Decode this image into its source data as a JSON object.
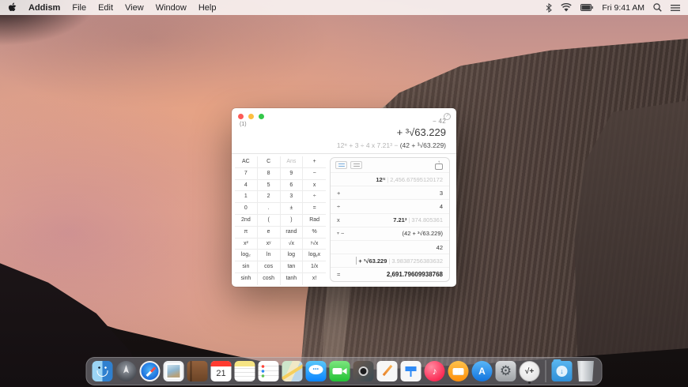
{
  "menubar": {
    "app_name": "Addism",
    "menus": [
      "File",
      "Edit",
      "View",
      "Window",
      "Help"
    ],
    "clock": "Fri 9:41 AM",
    "status_icons": [
      "bluetooth-icon",
      "wifi-icon",
      "battery-icon",
      "spotlight-icon",
      "notification-center-icon"
    ]
  },
  "window": {
    "tab_label": "(1)",
    "display": {
      "line1": "− 42",
      "line2": "+ ³√63.229",
      "expr": {
        "p1": "12",
        "s1": "π",
        "p2": " + 3 ÷ 4 x 7.21",
        "s2": "3",
        "p3": " − ",
        "dark": "(42 + ³√63.229)"
      }
    },
    "keypad": {
      "keys": [
        "AC",
        "C",
        "Ans",
        "+",
        "7",
        "8",
        "9",
        "−",
        "4",
        "5",
        "6",
        "x",
        "1",
        "2",
        "3",
        "÷",
        "0",
        ".",
        "±",
        "=",
        "2nd",
        "(",
        ")",
        "Rad",
        "π",
        "e",
        "rand",
        "%",
        "x²",
        "xʸ",
        "√x",
        "ʸ√x",
        "log₂",
        "ln",
        "log",
        "logᵧx",
        "sin",
        "cos",
        "tan",
        "1/x",
        "sinh",
        "cosh",
        "tanh",
        "x!"
      ]
    },
    "history": {
      "pipe": "|",
      "rows": [
        {
          "op": "",
          "main": "12",
          "sup": "π",
          "value": "2,456.67595120172"
        },
        {
          "op": "+",
          "main": "3"
        },
        {
          "op": "÷",
          "main": "4"
        },
        {
          "op": "x",
          "main": "7.21",
          "sup": "3",
          "value": "374.805361"
        },
        {
          "op": "−",
          "disclosure": "▾",
          "main": "(42 + ³√63.229)"
        },
        {
          "op": "",
          "main": "42"
        },
        {
          "op": "+",
          "main": "³√63.229",
          "value": "3.98387256383632"
        },
        {
          "op": "=",
          "main": "2,691.79609938768"
        }
      ]
    }
  },
  "dock": {
    "items": [
      {
        "name": "finder"
      },
      {
        "name": "launchpad"
      },
      {
        "name": "safari"
      },
      {
        "name": "mail"
      },
      {
        "name": "contacts"
      },
      {
        "name": "calendar",
        "day": "21"
      },
      {
        "name": "notes"
      },
      {
        "name": "reminders"
      },
      {
        "name": "maps"
      },
      {
        "name": "messages",
        "glyph": "•••"
      },
      {
        "name": "facetime"
      },
      {
        "name": "photo-booth"
      },
      {
        "name": "pages"
      },
      {
        "name": "keynote"
      },
      {
        "name": "itunes",
        "glyph": "♪"
      },
      {
        "name": "ibooks"
      },
      {
        "name": "app-store",
        "glyph": "A"
      },
      {
        "name": "system-preferences",
        "glyph": "⚙"
      },
      {
        "name": "addism",
        "glyph": "√+"
      },
      {
        "name": "downloads",
        "glyph": "↓"
      },
      {
        "name": "trash"
      }
    ]
  },
  "colors": {
    "traffic_red": "#fc5b57",
    "traffic_yellow": "#fdbe40",
    "traffic_green": "#34c84a",
    "history_value_grey": "#c2c2c2",
    "display_dark": "#3c3c3c"
  }
}
